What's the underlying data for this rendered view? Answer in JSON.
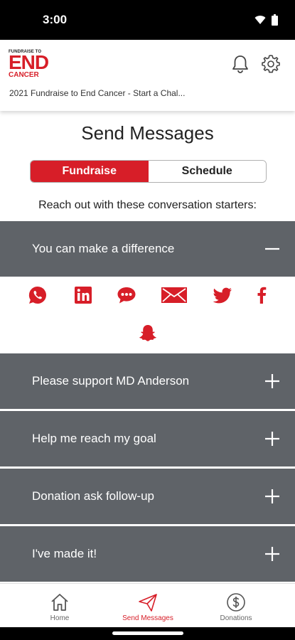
{
  "status_bar": {
    "time": "3:00"
  },
  "header": {
    "logo_top": "FUNDRAISE TO",
    "logo_main": "END",
    "logo_bottom": "CANCER",
    "subtitle": "2021 Fundraise to End Cancer - Start a Chal..."
  },
  "page": {
    "title": "Send Messages",
    "tabs": [
      {
        "label": "Fundraise",
        "active": true
      },
      {
        "label": "Schedule",
        "active": false
      }
    ],
    "intro": "Reach out with these conversation starters:"
  },
  "messages": [
    {
      "label": "You can make a difference",
      "expanded": true
    },
    {
      "label": "Please support MD Anderson",
      "expanded": false
    },
    {
      "label": "Help me reach my goal",
      "expanded": false
    },
    {
      "label": "Donation ask follow-up",
      "expanded": false
    },
    {
      "label": "I've made it!",
      "expanded": false
    }
  ],
  "share_options": [
    "whatsapp-icon",
    "linkedin-icon",
    "sms-icon",
    "email-icon",
    "twitter-icon",
    "facebook-icon",
    "snapchat-icon"
  ],
  "bottom_nav": [
    {
      "label": "Home",
      "icon": "home-icon",
      "active": false
    },
    {
      "label": "Send Messages",
      "icon": "paper-plane-icon",
      "active": true
    },
    {
      "label": "Donations",
      "icon": "dollar-icon",
      "active": false
    }
  ],
  "colors": {
    "brand_red": "#d71e28",
    "accordion_gray": "#5f6368"
  }
}
